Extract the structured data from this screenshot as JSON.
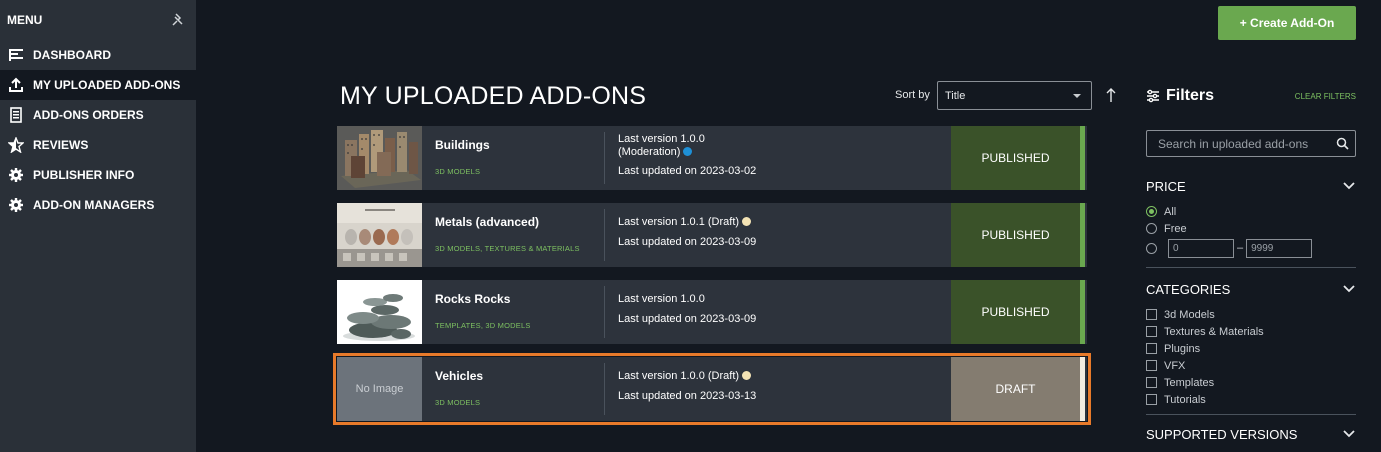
{
  "sidebar": {
    "title": "MENU",
    "pin_icon": "pin-icon",
    "items": [
      {
        "label": "DASHBOARD",
        "icon": "dashboard-icon",
        "active": false
      },
      {
        "label": "MY UPLOADED ADD-ONS",
        "icon": "upload-icon",
        "active": true
      },
      {
        "label": "ADD-ONS ORDERS",
        "icon": "orders-icon",
        "active": false
      },
      {
        "label": "REVIEWS",
        "icon": "star-icon",
        "active": false
      },
      {
        "label": "PUBLISHER INFO",
        "icon": "gear-icon",
        "active": false
      },
      {
        "label": "ADD-ON MANAGERS",
        "icon": "gear-icon",
        "active": false
      }
    ]
  },
  "header": {
    "create_button": "+ Create Add-On",
    "page_title": "MY UPLOADED ADD-ONS",
    "sort_label": "Sort by",
    "sort_value": "Title"
  },
  "addons": [
    {
      "title": "Buildings",
      "categories": "3D MODELS",
      "version": "Last version 1.0.0",
      "version_note": "(Moderation)",
      "dot_color": "#1e90d6",
      "updated": "Last updated on 2023-03-02",
      "status": "PUBLISHED",
      "status_type": "published",
      "stripe": "#6aa84f",
      "image": "buildings"
    },
    {
      "title": "Metals (advanced)",
      "categories": "3D MODELS, TEXTURES & MATERIALS",
      "version": "Last version 1.0.1 (Draft)",
      "version_note": "",
      "dot_color": "#f3e3b5",
      "updated": "Last updated on 2023-03-09",
      "status": "PUBLISHED",
      "status_type": "published",
      "stripe": "#6aa84f",
      "image": "metals"
    },
    {
      "title": "Rocks Rocks",
      "categories": "TEMPLATES, 3D MODELS",
      "version": "Last version 1.0.0",
      "version_note": "",
      "dot_color": "",
      "updated": "Last updated on 2023-03-09",
      "status": "PUBLISHED",
      "status_type": "published",
      "stripe": "#6aa84f",
      "image": "rocks"
    },
    {
      "title": "Vehicles",
      "categories": "3D MODELS",
      "version": "Last version 1.0.0 (Draft)",
      "version_note": "",
      "dot_color": "#f3e3b5",
      "updated": "Last updated on 2023-03-13",
      "status": "DRAFT",
      "status_type": "draft",
      "stripe": "#f3ece0",
      "image": "none",
      "no_image_label": "No Image",
      "selected": true
    }
  ],
  "filters": {
    "title": "Filters",
    "clear": "CLEAR FILTERS",
    "search_placeholder": "Search in uploaded add-ons",
    "price": {
      "label": "PRICE",
      "options": [
        "All",
        "Free"
      ],
      "selected": "All",
      "min_placeholder": "0",
      "max_placeholder": "9999"
    },
    "categories": {
      "label": "CATEGORIES",
      "options": [
        "3d Models",
        "Textures & Materials",
        "Plugins",
        "VFX",
        "Templates",
        "Tutorials"
      ]
    },
    "supported_versions": {
      "label": "SUPPORTED VERSIONS"
    }
  },
  "colors": {
    "accent_green": "#6aa84f",
    "selection_orange": "#e87a2a",
    "published_bg": "#3a5229",
    "draft_bg": "#847c70"
  }
}
